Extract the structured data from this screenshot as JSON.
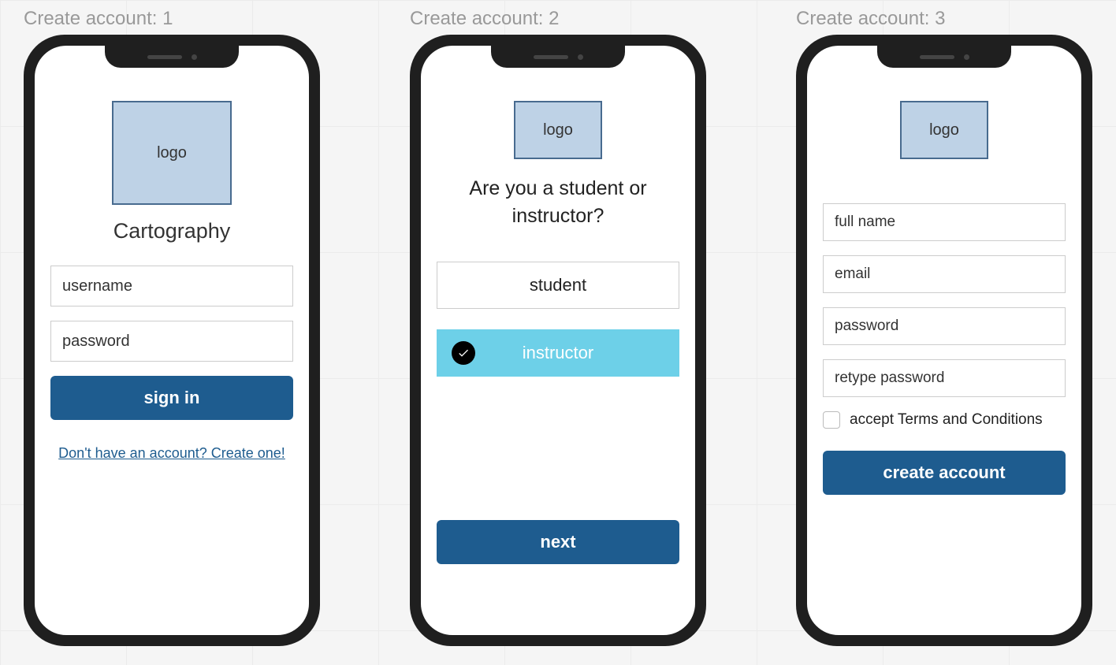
{
  "screens": {
    "s1": {
      "label": "Create account: 1",
      "logo_text": "logo",
      "title": "Cartography",
      "username_placeholder": "username",
      "password_placeholder": "password",
      "sign_in_label": "sign in",
      "create_link": "Don't have an account? Create one!"
    },
    "s2": {
      "label": "Create account: 2",
      "logo_text": "logo",
      "question": "Are you a student or instructor?",
      "option_student": "student",
      "option_instructor": "instructor",
      "next_label": "next"
    },
    "s3": {
      "label": "Create account: 3",
      "logo_text": "logo",
      "fullname_placeholder": "full name",
      "email_placeholder": "email",
      "password_placeholder": "password",
      "retype_placeholder": "retype password",
      "terms_label": "accept Terms and Conditions",
      "create_label": "create account"
    }
  }
}
